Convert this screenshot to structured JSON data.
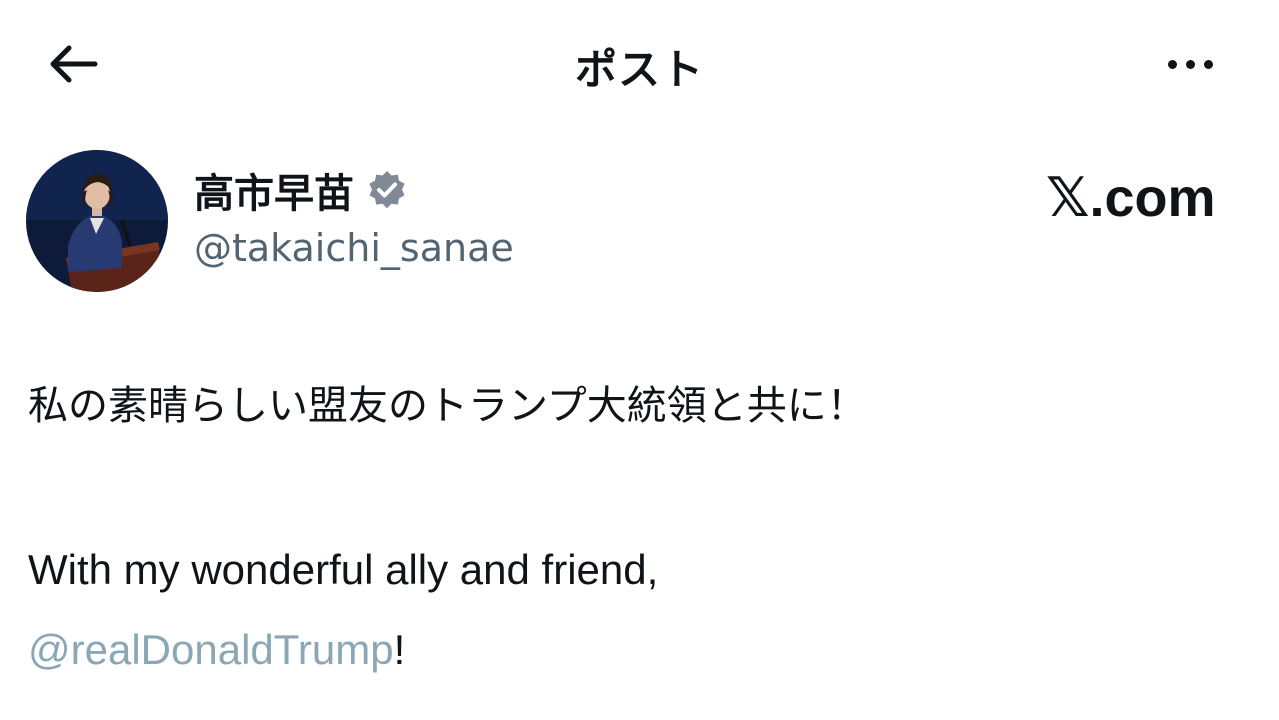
{
  "header": {
    "title": "ポスト",
    "back_icon": "arrow-left-icon",
    "more_icon": "more-horizontal-icon"
  },
  "author": {
    "display_name": "高市早苗",
    "handle": "@takaichi_sanae",
    "verified_icon": "verified-badge-icon",
    "verified_color": "#7f8a96"
  },
  "brand": {
    "label": "𝕏.com"
  },
  "post": {
    "text_jp": "私の素晴らしい盟友のトランプ大統領と共に！",
    "text_en_line1": "With my wonderful ally and friend,",
    "mention": "@realDonaldTrump",
    "mention_suffix": "!",
    "mention_color": "#8ba7b5"
  }
}
